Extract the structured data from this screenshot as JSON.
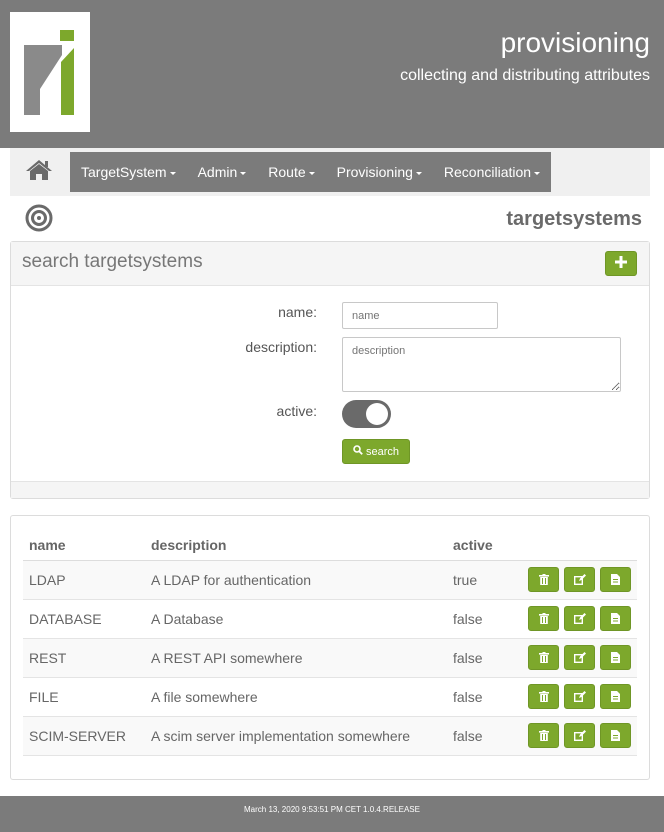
{
  "header": {
    "title": "provisioning",
    "subtitle": "collecting and distributing attributes"
  },
  "nav": {
    "items": [
      {
        "label": "TargetSystem"
      },
      {
        "label": "Admin"
      },
      {
        "label": "Route"
      },
      {
        "label": "Provisioning"
      },
      {
        "label": "Reconciliation"
      }
    ]
  },
  "page": {
    "title": "targetsystems"
  },
  "search": {
    "panel_title": "search targetsystems",
    "name_label": "name:",
    "name_placeholder": "name",
    "description_label": "description:",
    "description_placeholder": "description",
    "active_label": "active:",
    "active_value": true,
    "search_button": "search"
  },
  "table": {
    "columns": [
      "name",
      "description",
      "active"
    ],
    "rows": [
      {
        "name": "LDAP",
        "description": "A LDAP for authentication",
        "active": "true"
      },
      {
        "name": "DATABASE",
        "description": "A Database",
        "active": "false"
      },
      {
        "name": "REST",
        "description": "A REST API somewhere",
        "active": "false"
      },
      {
        "name": "FILE",
        "description": "A file somewhere",
        "active": "false"
      },
      {
        "name": "SCIM-SERVER",
        "description": "A scim server implementation somewhere",
        "active": "false"
      }
    ]
  },
  "footer": {
    "text": "March 13, 2020 9:53:51 PM CET 1.0.4.RELEASE"
  },
  "colors": {
    "accent": "#7da82c",
    "header_bg": "#7b7b7b"
  }
}
